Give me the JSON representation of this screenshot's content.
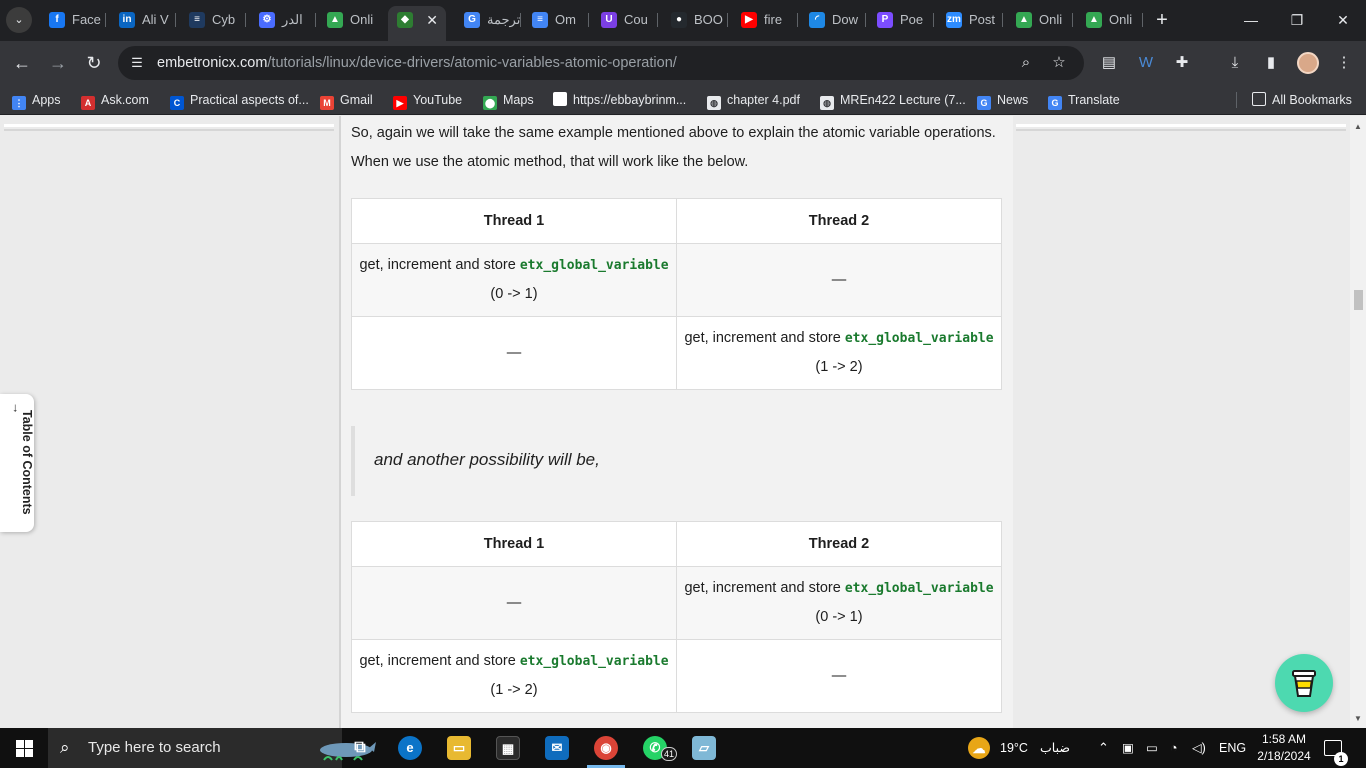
{
  "tabs": [
    {
      "title": "Face",
      "icon": "facebook-icon",
      "color": "#1877f2",
      "glyph": "f"
    },
    {
      "title": "Ali V",
      "icon": "linkedin-icon",
      "color": "#0a66c2",
      "glyph": "in"
    },
    {
      "title": "Cyb",
      "icon": "cyber-site-icon",
      "color": "#1f3a5f",
      "glyph": "≡"
    },
    {
      "title": "الدر",
      "icon": "gear-icon",
      "color": "#4a6cff",
      "glyph": "⚙"
    },
    {
      "title": "Onli",
      "icon": "google-drive-icon",
      "color": "#34a853",
      "glyph": "▲"
    },
    {
      "title": "",
      "icon": "embetronicx-icon",
      "color": "#2e7d32",
      "glyph": "◆"
    },
    {
      "title": "ترجمة",
      "icon": "google-translate-icon",
      "color": "#4285f4",
      "glyph": "G"
    },
    {
      "title": "Om",
      "icon": "google-docs-icon",
      "color": "#4285f4",
      "glyph": "≡"
    },
    {
      "title": "Cou",
      "icon": "course-icon",
      "color": "#7b3fe4",
      "glyph": "U"
    },
    {
      "title": "BOO",
      "icon": "github-icon",
      "color": "#24292e",
      "glyph": "●"
    },
    {
      "title": "fire",
      "icon": "youtube-icon",
      "color": "#ff0000",
      "glyph": "▶"
    },
    {
      "title": "Dow",
      "icon": "loading-icon",
      "color": "#1e88e5",
      "glyph": "◜"
    },
    {
      "title": "Poe",
      "icon": "poe-icon",
      "color": "#7c4dff",
      "glyph": "P"
    },
    {
      "title": "Post",
      "icon": "zoom-icon",
      "color": "#2d8cff",
      "glyph": "zm"
    },
    {
      "title": "Onli",
      "icon": "google-drive-icon",
      "color": "#34a853",
      "glyph": "▲"
    },
    {
      "title": "Onli",
      "icon": "google-drive-icon",
      "color": "#34a853",
      "glyph": "▲"
    }
  ],
  "address": {
    "host": "embetronicx.com",
    "path": "/tutorials/linux/device-drivers/atomic-variables-atomic-operation/"
  },
  "bookmarks": [
    {
      "label": "Apps",
      "icon": "apps-grid-icon",
      "color": "#4285f4",
      "glyph": "⋮"
    },
    {
      "label": "Ask.com",
      "icon": "ask-icon",
      "color": "#d32f2f",
      "glyph": "A"
    },
    {
      "label": "Practical aspects of...",
      "icon": "coursera-icon",
      "color": "#0056d2",
      "glyph": "C"
    },
    {
      "label": "Gmail",
      "icon": "gmail-icon",
      "color": "#ea4335",
      "glyph": "M"
    },
    {
      "label": "YouTube",
      "icon": "youtube-icon",
      "color": "#ff0000",
      "glyph": "▶"
    },
    {
      "label": "Maps",
      "icon": "maps-icon",
      "color": "#34a853",
      "glyph": "⬤"
    },
    {
      "label": "https://ebbaybrinm...",
      "icon": "page-icon",
      "color": "#ffffff",
      "glyph": ""
    },
    {
      "label": "chapter 4.pdf",
      "icon": "globe-icon",
      "color": "#e8eaed",
      "glyph": "◍"
    },
    {
      "label": "MREn422 Lecture (7...",
      "icon": "globe-icon",
      "color": "#e8eaed",
      "glyph": "◍"
    },
    {
      "label": "News",
      "icon": "google-news-icon",
      "color": "#4285f4",
      "glyph": "G"
    },
    {
      "label": "Translate",
      "icon": "google-translate-icon",
      "color": "#4285f4",
      "glyph": "G"
    }
  ],
  "all_bookmarks": "All Bookmarks",
  "article": {
    "intro": "So, again we will take the same example mentioned above to explain the atomic variable operations.",
    "intro2": "When we use the atomic method, that will work like the below.",
    "quote": "and another possibility will be,",
    "table1": {
      "header": [
        "Thread 1",
        "Thread 2"
      ],
      "row1": {
        "t1_pre": "get, increment and store ",
        "t1_code": "etx_global_variable",
        "t1_post": "(0 -> 1)",
        "t2": "—"
      },
      "row2": {
        "t1": "—",
        "t2_pre": "get, increment and store ",
        "t2_code": "etx_global_variable",
        "t2_post": "(1 -> 2)"
      }
    },
    "table2": {
      "header": [
        "Thread 1",
        "Thread 2"
      ],
      "row1": {
        "t1": "—",
        "t2_pre": "get, increment and store ",
        "t2_code": "etx_global_variable",
        "t2_post": "(0 -> 1)"
      },
      "row2": {
        "t1_pre": "get, increment and store ",
        "t1_code": "etx_global_variable",
        "t1_post": "(1 -> 2)",
        "t2": "—"
      }
    }
  },
  "toc_label": "Table of Contents",
  "taskbar": {
    "search_placeholder": "Type here to search",
    "whatsapp_badge": "41",
    "weather_temp": "19°C",
    "weather_text": "ضباب",
    "language": "ENG",
    "time": "1:58 AM",
    "date": "2/18/2024",
    "notification_count": "1"
  },
  "colors": {
    "accent_code": "#1a7a2e",
    "coffee_button": "#4dd9b0"
  }
}
